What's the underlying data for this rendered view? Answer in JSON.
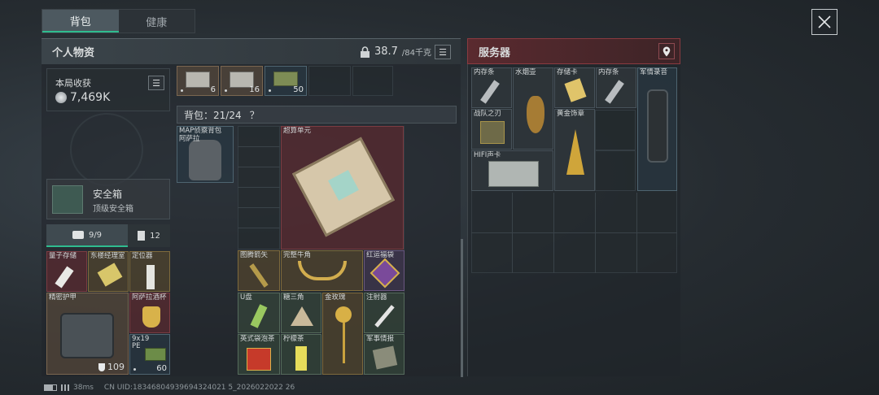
{
  "tabs": {
    "backpack": "背包",
    "health": "健康"
  },
  "personal": {
    "title": "个人物资",
    "weight_value": "38.7",
    "weight_max": "/84千克"
  },
  "server": {
    "title": "服务器"
  },
  "harvest": {
    "label": "本局收获",
    "value": "7,469K"
  },
  "top_counts": [
    "6",
    "16",
    "50"
  ],
  "backpack_label": "背包：21/24",
  "help_mark": "？",
  "safe": {
    "name": "安全箱",
    "desc": "顶级安全箱"
  },
  "case_tabs": {
    "a": "9/9",
    "b": "12"
  },
  "left_items": {
    "quantum": "量子存储",
    "dongfang": "东楼经理室",
    "locator": "定位器",
    "armor": "精密护甲",
    "cup": "阿萨拉酒杯",
    "ammo_line1": "9x19",
    "ammo_line2": "PE",
    "armor_dur": "109",
    "ammo_count": "60"
  },
  "bag": {
    "name_line1": "MAP侦察背包",
    "name_line2": "阿萨拉"
  },
  "center_items": {
    "super": "超算单元",
    "arrow": "图腾箭矢",
    "horn": "完整牛角",
    "bag_red": "红运福袋",
    "usb": "U盘",
    "triangle": "糖三角",
    "rose": "金玫瑰",
    "syringe": "注射器",
    "tea": "英式袋泡茶",
    "lemon": "柠檬茶",
    "intel": "军事情报"
  },
  "server_items": {
    "mem1": "内存条",
    "hookah": "水烟壶",
    "sdcard": "存储卡",
    "mem2": "内存条",
    "recorder": "军情录音",
    "warblade": "战队之刃",
    "gold_badge": "黄金饰章",
    "hifi": "HIFI声卡"
  },
  "status": {
    "ping": "38ms",
    "uid": "CN UID:18346804939694324021 5_2026022022 26"
  },
  "colors": {
    "accent": "#2fbc8f",
    "server_red": "#8a3a40"
  }
}
